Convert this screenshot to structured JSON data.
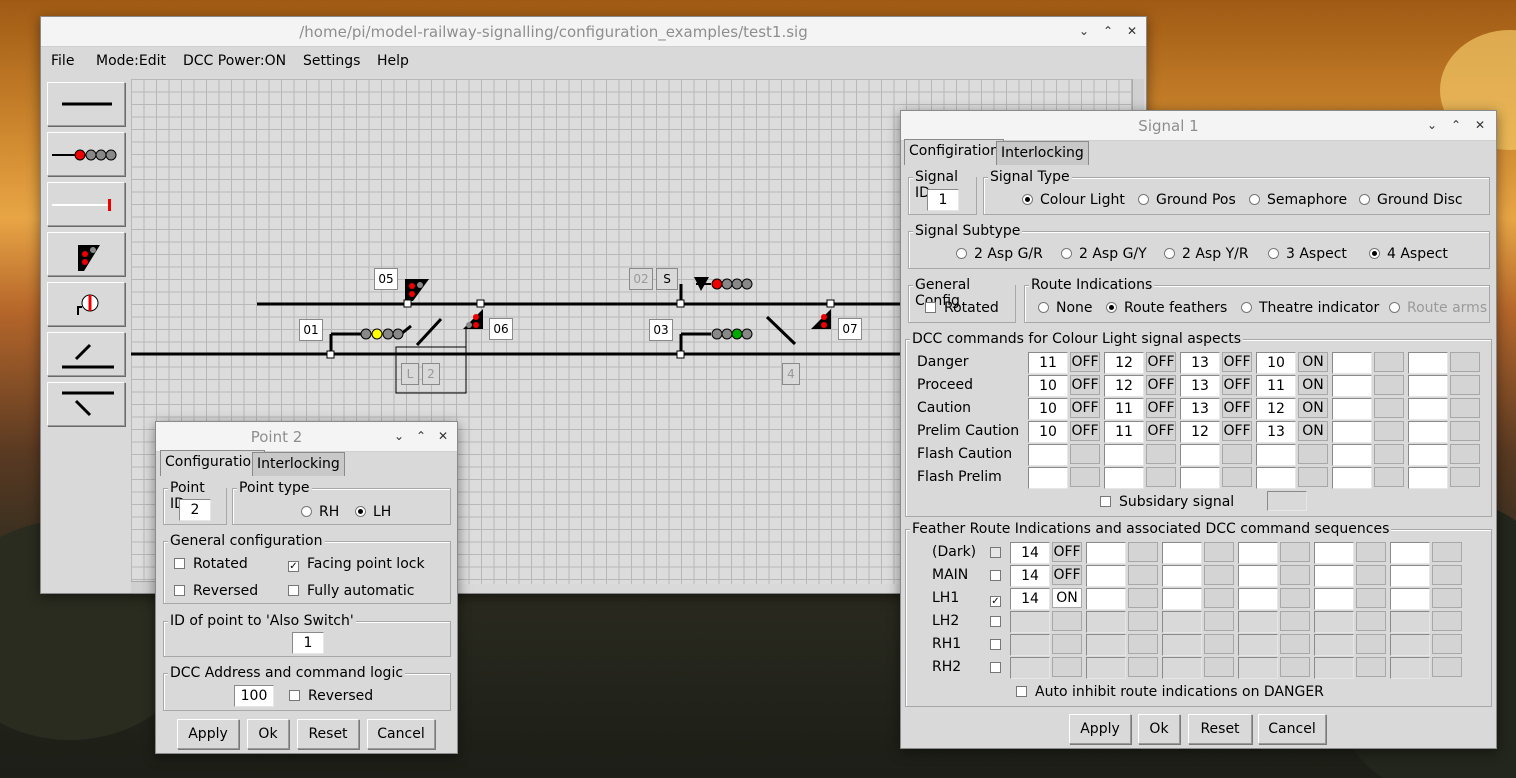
{
  "main_window": {
    "title": "/home/pi/model-railway-signalling/configuration_examples/test1.sig",
    "menu": [
      "File",
      "Mode:Edit",
      "DCC Power:ON",
      "Settings",
      "Help"
    ],
    "tools": [
      "line-tool-icon",
      "colour-light-signal-icon",
      "ground-position-signal-icon",
      "semaphore-signal-icon",
      "ground-disc-signal-icon",
      "right-hand-point-icon",
      "left-hand-point-icon"
    ],
    "schematic_labels": {
      "signal_05": "05",
      "signal_06": "06",
      "signal_07": "07",
      "point_01": "01",
      "point_03": "03",
      "item_02": "02",
      "item_S": "S",
      "item_L": "L",
      "item_2": "2",
      "item_4": "4"
    }
  },
  "point_window": {
    "title": "Point 2",
    "tabs": [
      "Configuration",
      "Interlocking"
    ],
    "point_id_label": "Point ID",
    "point_id_value": "2",
    "point_type_label": "Point type",
    "point_type_options": [
      "RH",
      "LH"
    ],
    "point_type_selected": "LH",
    "general_label": "General configuration",
    "rotated_label": "Rotated",
    "rotated": false,
    "facing_label": "Facing point lock",
    "facing": true,
    "reversed_label": "Reversed",
    "reversed": false,
    "auto_label": "Fully automatic",
    "auto": false,
    "also_switch_label": "ID of point to 'Also Switch'",
    "also_switch_value": "1",
    "dcc_label": "DCC Address and command logic",
    "dcc_value": "100",
    "dcc_reversed_label": "Reversed",
    "dcc_reversed": false,
    "buttons": [
      "Apply",
      "Ok",
      "Reset",
      "Cancel"
    ]
  },
  "signal_window": {
    "title": "Signal 1",
    "tabs": [
      "Configiration",
      "Interlocking"
    ],
    "signal_id_label": "Signal ID",
    "signal_id_value": "1",
    "signal_type_label": "Signal Type",
    "signal_types": [
      "Colour Light",
      "Ground Pos",
      "Semaphore",
      "Ground Disc"
    ],
    "signal_type_selected": "Colour Light",
    "subtype_label": "Signal Subtype",
    "subtypes": [
      "2 Asp G/R",
      "2 Asp G/Y",
      "2 Asp Y/R",
      "3 Aspect",
      "4 Aspect"
    ],
    "subtype_selected": "4 Aspect",
    "general_label": "General Config",
    "rotated_label": "Rotated",
    "rotated": false,
    "route_ind_label": "Route Indications",
    "route_ind_options": [
      "None",
      "Route feathers",
      "Theatre indicator",
      "Route arms"
    ],
    "route_ind_selected": "Route feathers",
    "dcc_label": "DCC commands for Colour Light signal aspects",
    "aspect_rows": [
      {
        "label": "Danger",
        "cells": [
          "11",
          "OFF",
          "12",
          "OFF",
          "13",
          "OFF",
          "10",
          "ON",
          "",
          "",
          "",
          ""
        ]
      },
      {
        "label": "Proceed",
        "cells": [
          "10",
          "OFF",
          "12",
          "OFF",
          "13",
          "OFF",
          "11",
          "ON",
          "",
          "",
          "",
          ""
        ]
      },
      {
        "label": "Caution",
        "cells": [
          "10",
          "OFF",
          "11",
          "OFF",
          "13",
          "OFF",
          "12",
          "ON",
          "",
          "",
          "",
          ""
        ]
      },
      {
        "label": "Prelim Caution",
        "cells": [
          "10",
          "OFF",
          "11",
          "OFF",
          "12",
          "OFF",
          "13",
          "ON",
          "",
          "",
          "",
          ""
        ]
      },
      {
        "label": "Flash Caution",
        "cells": [
          "",
          "",
          "",
          "",
          "",
          "",
          "",
          "",
          "",
          "",
          "",
          ""
        ]
      },
      {
        "label": "Flash Prelim",
        "cells": [
          "",
          "",
          "",
          "",
          "",
          "",
          "",
          "",
          "",
          "",
          "",
          ""
        ]
      }
    ],
    "subsidiary_label": "Subsidary signal",
    "subsidiary": false,
    "feather_label": "Feather Route Indications and associated DCC command sequences",
    "feather_rows": [
      {
        "label": "(Dark)",
        "checked": false,
        "enabled": false,
        "cells": [
          "14",
          "OFF",
          "",
          "",
          "",
          "",
          "",
          "",
          "",
          "",
          "",
          ""
        ]
      },
      {
        "label": "MAIN",
        "checked": false,
        "enabled": true,
        "cells": [
          "14",
          "OFF",
          "",
          "",
          "",
          "",
          "",
          "",
          "",
          "",
          "",
          ""
        ]
      },
      {
        "label": "LH1",
        "checked": true,
        "enabled": true,
        "cells": [
          "14",
          "ON",
          "",
          "",
          "",
          "",
          "",
          "",
          "",
          "",
          "",
          ""
        ]
      },
      {
        "label": "LH2",
        "checked": false,
        "enabled": true,
        "cells": [
          "",
          "",
          "",
          "",
          "",
          "",
          "",
          "",
          "",
          "",
          "",
          ""
        ]
      },
      {
        "label": "RH1",
        "checked": false,
        "enabled": true,
        "cells": [
          "",
          "",
          "",
          "",
          "",
          "",
          "",
          "",
          "",
          "",
          "",
          ""
        ]
      },
      {
        "label": "RH2",
        "checked": false,
        "enabled": true,
        "cells": [
          "",
          "",
          "",
          "",
          "",
          "",
          "",
          "",
          "",
          "",
          "",
          ""
        ]
      }
    ],
    "auto_inhibit_label": "Auto inhibit route indications on DANGER",
    "auto_inhibit": false,
    "buttons": [
      "Apply",
      "Ok",
      "Reset",
      "Cancel"
    ]
  }
}
